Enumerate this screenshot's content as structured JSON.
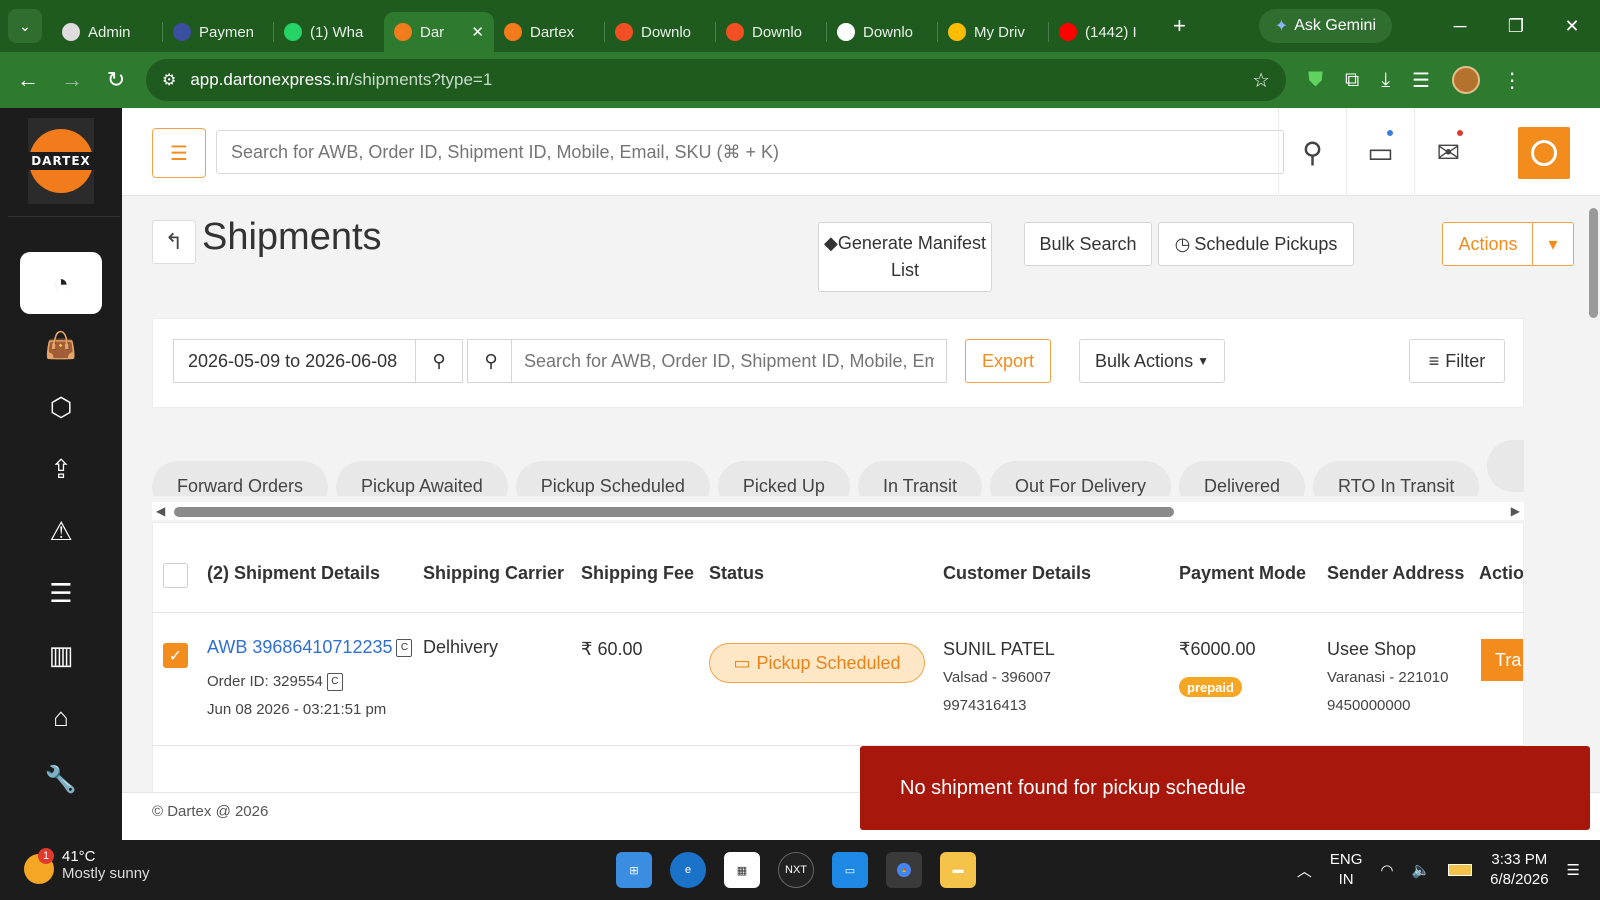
{
  "browser": {
    "tabs": [
      {
        "label": "Admin",
        "icon": "globe-icon",
        "color": "#dddddd"
      },
      {
        "label": "Paymen",
        "icon": "s-icon",
        "color": "#3b4ea0"
      },
      {
        "label": "(1) Wha",
        "icon": "whatsapp-icon",
        "color": "#25d366"
      },
      {
        "label": "Dar",
        "icon": "dartex-icon",
        "color": "#f27c1c",
        "active": true
      },
      {
        "label": "Dartex",
        "icon": "dartex-icon",
        "color": "#f27c1c"
      },
      {
        "label": "Downlo",
        "icon": "microsoft-icon",
        "color": "#f25022"
      },
      {
        "label": "Downlo",
        "icon": "microsoft-icon",
        "color": "#f25022"
      },
      {
        "label": "Downlo",
        "icon": "download-icon",
        "color": "#ffffff"
      },
      {
        "label": "My Driv",
        "icon": "drive-icon",
        "color": "#fbbc04"
      },
      {
        "label": "(1442) I",
        "icon": "youtube-icon",
        "color": "#ff0000"
      }
    ],
    "ask_gemini": "Ask Gemini",
    "url_host": "app.dartonexpress.in",
    "url_path": "/shipments?type=1"
  },
  "header": {
    "search_placeholder": "Search for AWB, Order ID, Shipment ID, Mobile, Email, SKU (⌘ + K)"
  },
  "page": {
    "title": "Shipments",
    "generate_manifest": "Generate Manifest List",
    "bulk_search": "Bulk Search",
    "schedule_pickups": "Schedule Pickups",
    "actions": "Actions"
  },
  "filters": {
    "date_range": "2026-05-09 to 2026-06-08",
    "search_placeholder": "Search for AWB, Order ID, Shipment ID, Mobile, Email",
    "export": "Export",
    "bulk_actions": "Bulk Actions",
    "filter": "Filter"
  },
  "status_tabs": [
    "Forward Orders",
    "Pickup Awaited",
    "Pickup Scheduled",
    "Picked Up",
    "In Transit",
    "Out For Delivery",
    "Delivered",
    "RTO In Transit"
  ],
  "table": {
    "headers": {
      "shipment_details": "(2) Shipment Details",
      "carrier": "Shipping Carrier",
      "fee": "Shipping Fee",
      "status": "Status",
      "customer": "Customer Details",
      "payment": "Payment Mode",
      "sender": "Sender Address",
      "action": "Actio"
    },
    "rows": [
      {
        "awb": "AWB 39686410712235",
        "order_id": "Order ID: 329554",
        "date": "Jun 08 2026 - 03:21:51 pm",
        "carrier": "Delhivery",
        "fee": "₹ 60.00",
        "status": "Pickup Scheduled",
        "customer_name": "SUNIL PATEL",
        "customer_city": "Valsad - 396007",
        "customer_phone": "9974316413",
        "amount": "₹6000.00",
        "payment_mode": "prepaid",
        "sender_name": "Usee Shop",
        "sender_city": "Varanasi - 221010",
        "sender_phone": "9450000000",
        "action_label": "Tra"
      }
    ]
  },
  "footer": "© Dartex @ 2026",
  "toast": "No shipment found for pickup schedule",
  "taskbar": {
    "temperature": "41°C",
    "condition": "Mostly sunny",
    "notification_count": "1",
    "lang_top": "ENG",
    "lang_bottom": "IN",
    "time": "3:33 PM",
    "date": "6/8/2026"
  },
  "colors": {
    "brand": "#f28c1c",
    "chrome": "#2e7a2e",
    "toast": "#a8170c",
    "link": "#2f6fd6"
  }
}
